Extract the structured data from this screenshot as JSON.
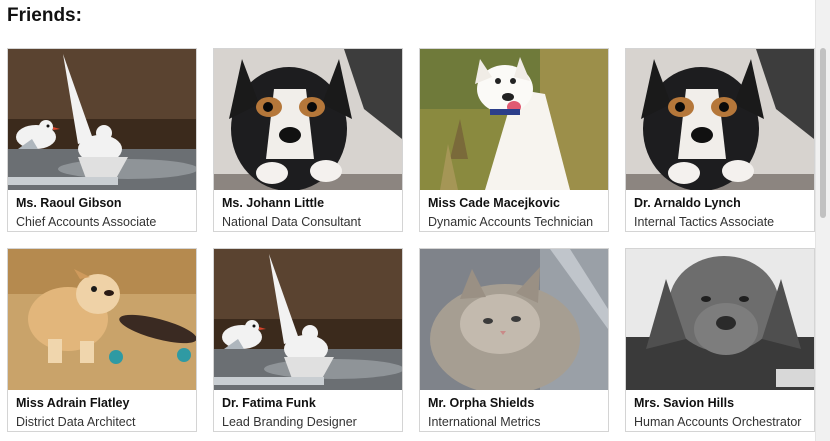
{
  "page": {
    "heading": "Friends:"
  },
  "friends": [
    {
      "name": "Ms. Raoul Gibson",
      "title": "Chief Accounts Associate",
      "photo": "seagulls"
    },
    {
      "name": "Ms. Johann Little",
      "title": "National Data Consultant",
      "photo": "puppy-tricolor"
    },
    {
      "name": "Miss Cade Macejkovic",
      "title": "Dynamic Accounts Technician",
      "photo": "white-puppy"
    },
    {
      "name": "Dr. Arnaldo Lynch",
      "title": "Internal Tactics Associate",
      "photo": "puppy-tricolor"
    },
    {
      "name": "Miss Adrain Flatley",
      "title": "District Data Architect",
      "photo": "bulldog-skateboard"
    },
    {
      "name": "Dr. Fatima Funk",
      "title": "Lead Branding Designer",
      "photo": "seagulls"
    },
    {
      "name": "Mr. Orpha Shields",
      "title": "International Metrics Representative",
      "photo": "grey-cat"
    },
    {
      "name": "Mrs. Savion Hills",
      "title": "Human Accounts Orchestrator",
      "photo": "sad-dog-bw"
    }
  ]
}
